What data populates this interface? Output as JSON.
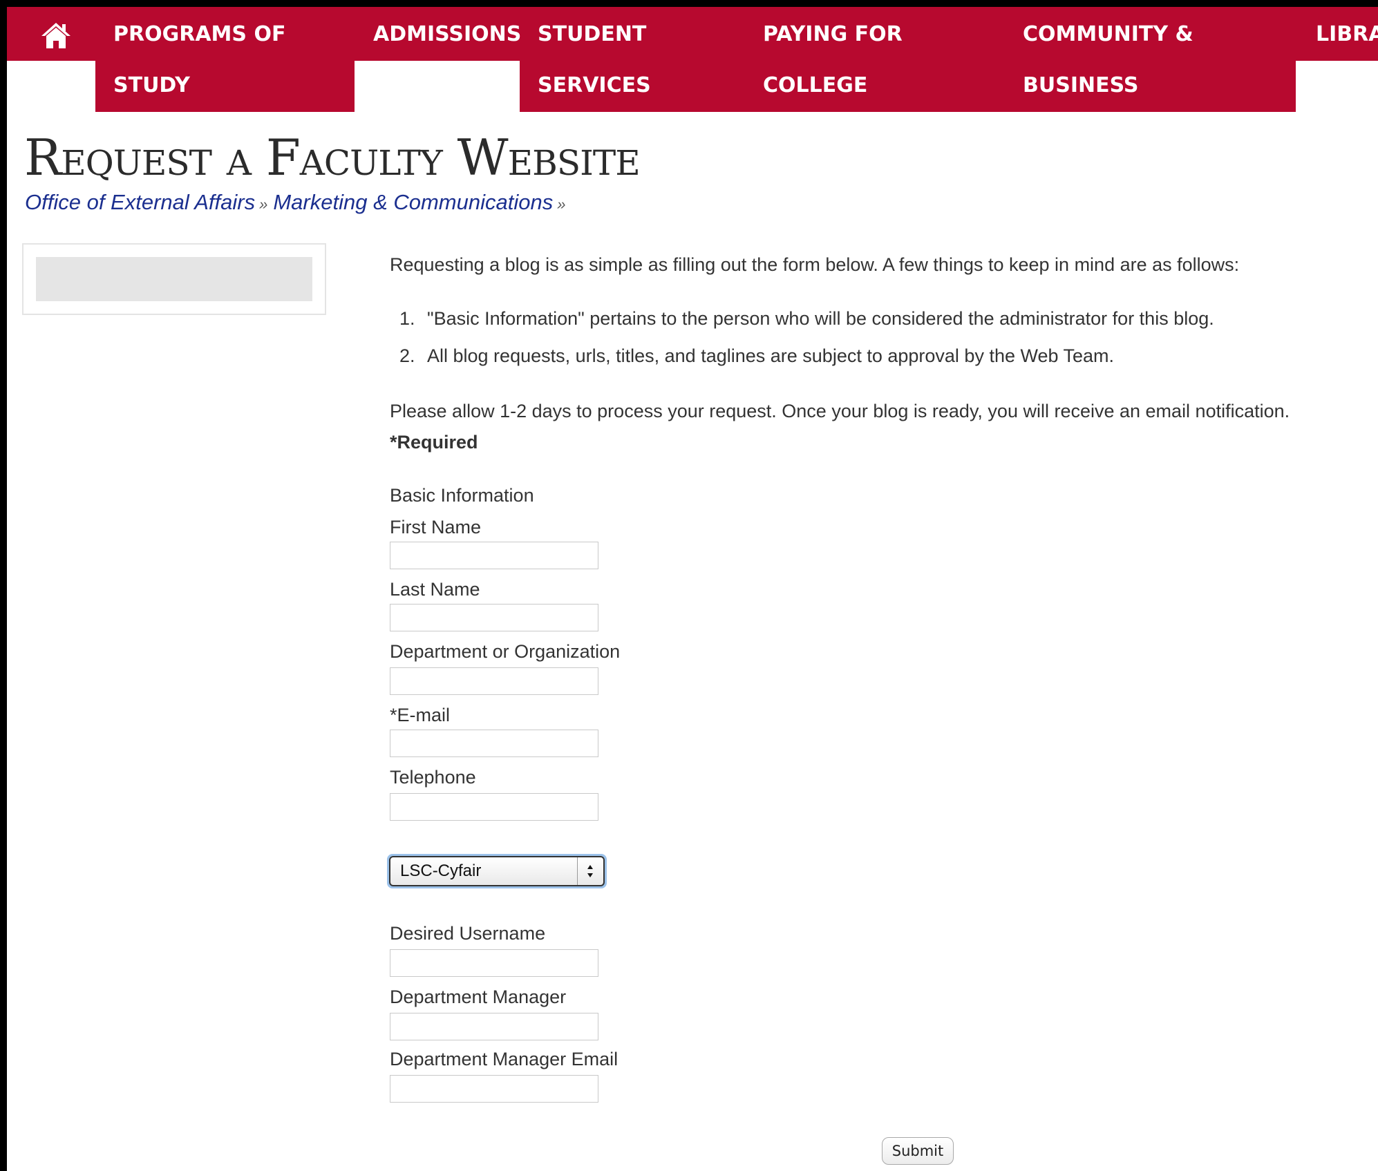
{
  "nav": {
    "items": [
      {
        "line1": "Programs of",
        "line2": "Study"
      },
      {
        "line1": "Admissions",
        "line2": ""
      },
      {
        "line1": "Student",
        "line2": "Services"
      },
      {
        "line1": "Paying for",
        "line2": "College"
      },
      {
        "line1": "Community &",
        "line2": "Business"
      },
      {
        "line1": "Librai",
        "line2": ""
      }
    ]
  },
  "page": {
    "title": "Request a Faculty Website",
    "breadcrumb": [
      "Office of External Affairs",
      "Marketing & Communications"
    ],
    "breadcrumb_sep": "»"
  },
  "intro": {
    "text": "Requesting a blog is as simple as filling out the form below. A few things to keep in mind are as follows:",
    "list": [
      {
        "num": "1.",
        "text": "\"Basic Information\" pertains to the person who will be considered the administrator for this blog."
      },
      {
        "num": "2.",
        "text": "All blog requests, urls, titles, and taglines are subject to approval by the Web Team."
      }
    ],
    "allow": "Please allow 1-2 days to process your request. Once your blog is ready, you will receive an email notification.",
    "required": "*Required"
  },
  "form": {
    "section_label": "Basic Information",
    "first_name": {
      "label": "First Name",
      "value": ""
    },
    "last_name": {
      "label": "Last Name",
      "value": ""
    },
    "department": {
      "label": "Department or Organization",
      "value": ""
    },
    "email": {
      "label": "*E-mail",
      "value": ""
    },
    "telephone": {
      "label": "Telephone",
      "value": ""
    },
    "campus_select": {
      "value": "LSC-Cyfair"
    },
    "username": {
      "label": "Desired Username",
      "value": ""
    },
    "manager": {
      "label": "Department Manager",
      "value": ""
    },
    "manager_email": {
      "label": "Department Manager Email",
      "value": ""
    },
    "submit_label": "Submit"
  },
  "colors": {
    "nav_bg": "#b7092f",
    "link": "#1b2f8f",
    "text": "#333333"
  },
  "icons": {
    "home": "home-icon",
    "select_arrows": "up-down-arrows-icon"
  }
}
